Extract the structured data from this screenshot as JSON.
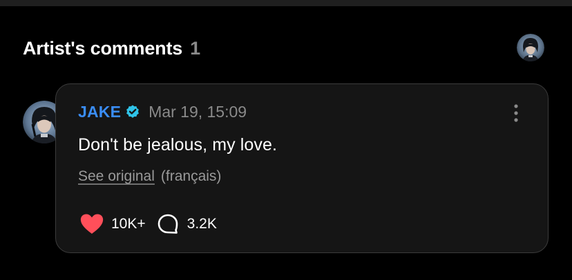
{
  "header": {
    "title": "Artist's comments",
    "count": "1"
  },
  "comment": {
    "author": "JAKE",
    "timestamp": "Mar 19, 15:09",
    "text": "Don't be jealous, my love.",
    "see_original_label": "See original",
    "language": "(français)",
    "like_count": "10K+",
    "reply_count": "3.2K"
  },
  "icons": {
    "verified": "verified-badge-icon",
    "more": "more-vertical-icon",
    "like": "heart-icon",
    "reply": "speech-bubble-icon"
  },
  "colors": {
    "background": "#000000",
    "card_background": "#151515",
    "card_border": "#3c3c3c",
    "author_name": "#3a8df5",
    "verified_badge": "#2fc3e8",
    "heart": "#ff4f5a",
    "muted_text": "#8a8a8a"
  }
}
